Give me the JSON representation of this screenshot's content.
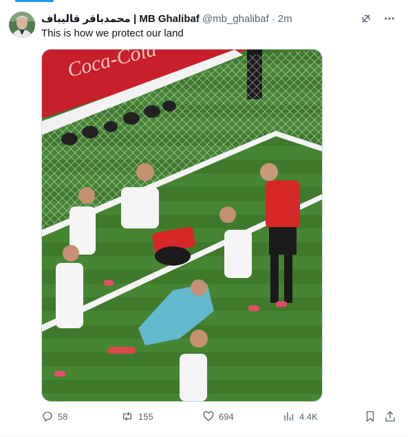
{
  "tweet": {
    "author_name": "محمدباقر قالیباف | MB Ghalibaf",
    "handle": "@mb_ghalibaf",
    "separator": "·",
    "time": "2m",
    "text": "This is how we protect our land"
  },
  "actions": {
    "replies": "58",
    "reposts": "155",
    "likes": "694",
    "views": "4.4K"
  },
  "icons": {
    "grok": "grok-icon",
    "more": "more-icon",
    "reply": "reply-icon",
    "repost": "repost-icon",
    "like": "heart-icon",
    "views": "views-icon",
    "bookmark": "bookmark-icon",
    "share": "share-icon"
  },
  "colors": {
    "accent": "#1d9bf0",
    "text_primary": "#0f1419",
    "text_secondary": "#536471"
  }
}
